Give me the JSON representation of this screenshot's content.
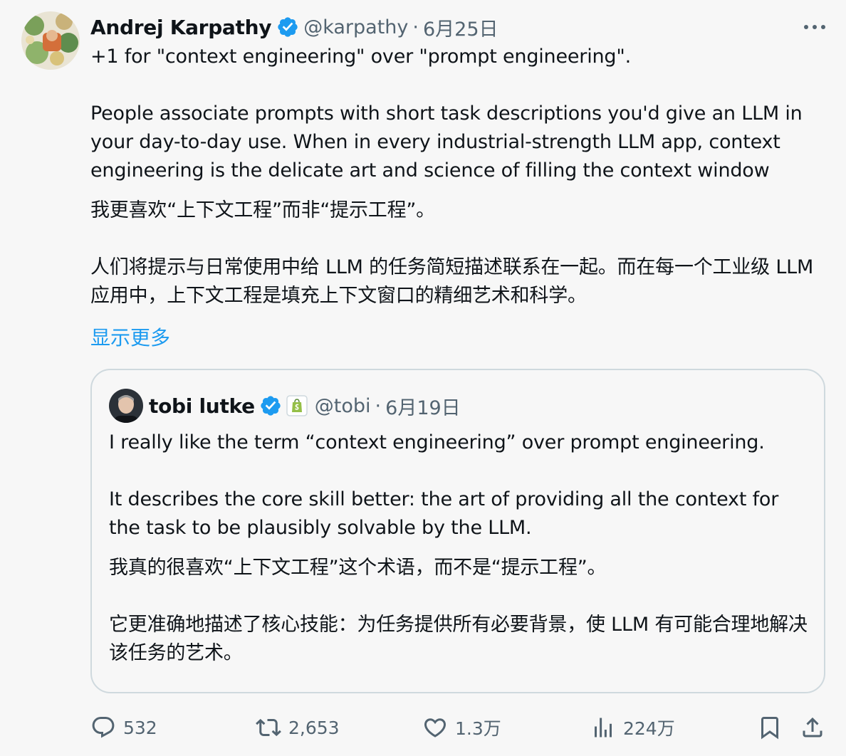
{
  "tweet": {
    "author_name": "Andrej Karpathy",
    "author_handle": "@karpathy",
    "separator": "·",
    "date": "6月25日",
    "text_line1": "+1 for \"context engineering\" over \"prompt engineering\".",
    "text_para2": "People associate prompts with short task descriptions you'd give an LLM in your day-to-day use. When in every industrial-strength LLM app, context engineering is the delicate art and science of filling the context window",
    "zh_line1": "我更喜欢“上下文工程”而非“提示工程”。",
    "zh_para2": "人们将提示与日常使用中给 LLM 的任务简短描述联系在一起。而在每一个工业级 LLM 应用中，上下文工程是填充上下文窗口的精细艺术和科学。",
    "show_more": "显示更多"
  },
  "quote": {
    "author_name": "tobi lutke",
    "author_handle": "@tobi",
    "separator": "·",
    "date": "6月19日",
    "text_line1": "I really like the term “context engineering” over prompt engineering.",
    "text_para2": "It describes the core skill better: the art of providing all the context for the task to be plausibly solvable by the LLM.",
    "zh_line1": "我真的很喜欢“上下文工程”这个术语，而不是“提示工程”。",
    "zh_para2": "它更准确地描述了核心技能：为任务提供所有必要背景，使 LLM 有可能合理地解决该任务的艺术。"
  },
  "actions": {
    "replies": "532",
    "reposts": "2,653",
    "likes": "1.3万",
    "views": "224万"
  },
  "icons": {
    "verified": "verified-badge-icon",
    "more": "more-icon",
    "reply": "reply-icon",
    "repost": "repost-icon",
    "like": "heart-icon",
    "views": "views-icon",
    "bookmark": "bookmark-icon",
    "share": "share-icon",
    "shopify": "shopify-badge-icon"
  },
  "colors": {
    "accent": "#1d9bf0",
    "secondary_text": "#536471",
    "border": "#cfd9de",
    "background": "#f7f7f7"
  }
}
